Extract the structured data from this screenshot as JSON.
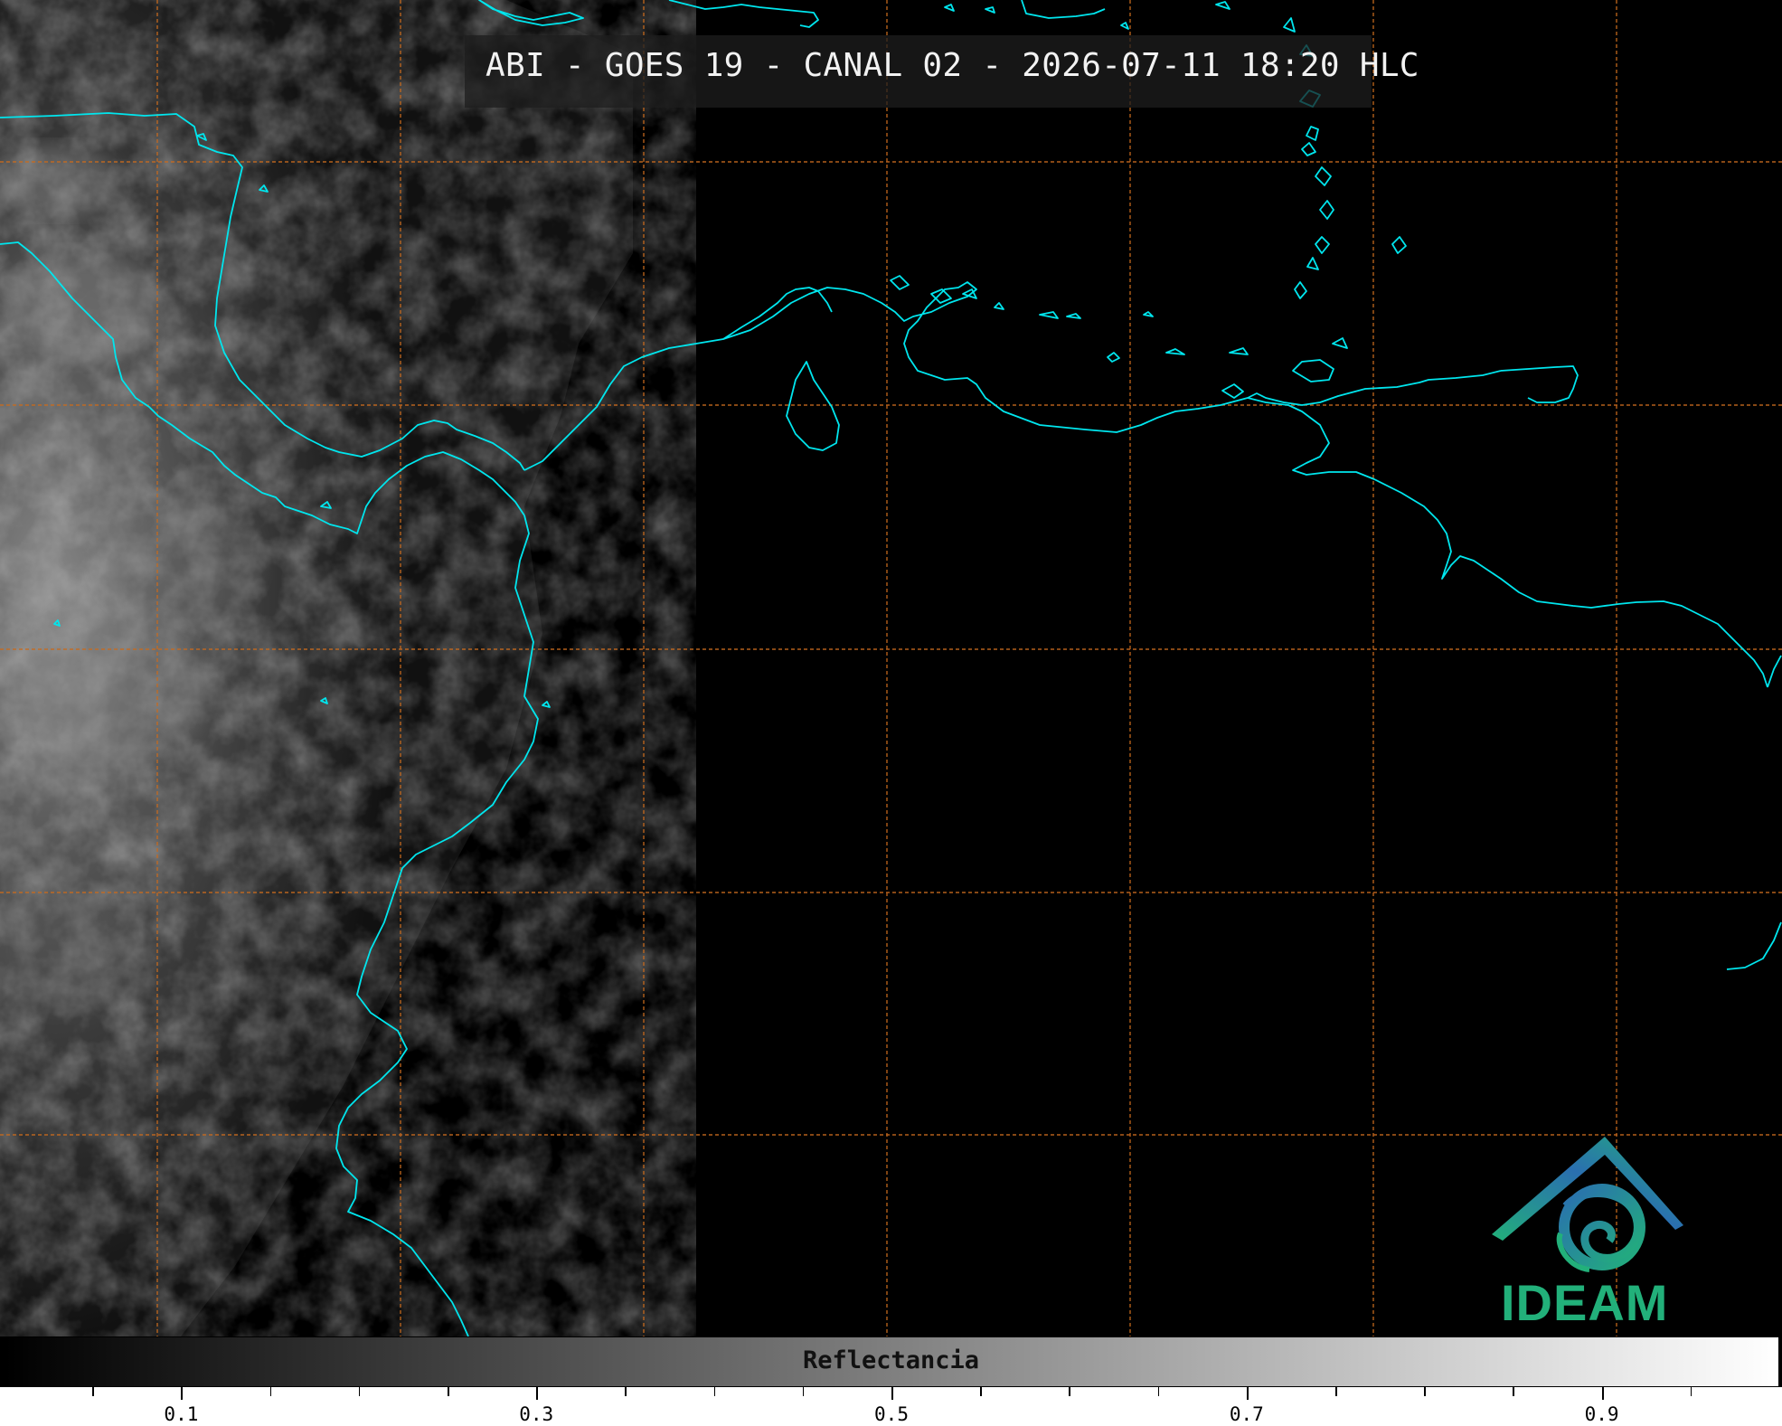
{
  "title": "ABI - GOES 19 - CANAL 02 - 2026-07-11 18:20 HLC",
  "colorbar": {
    "label": "Reflectancia",
    "ticks": [
      "0.1",
      "0.3",
      "0.5",
      "0.7",
      "0.9"
    ],
    "range": [
      0.0,
      1.0
    ]
  },
  "logo": {
    "text": "IDEAM"
  },
  "colors": {
    "coastline": "#00e6ee",
    "grid": "#c86a1e",
    "logo_green": "#22b07a",
    "logo_blue": "#2a6fb0"
  },
  "icons": [
    "ideam-logo-icon"
  ]
}
